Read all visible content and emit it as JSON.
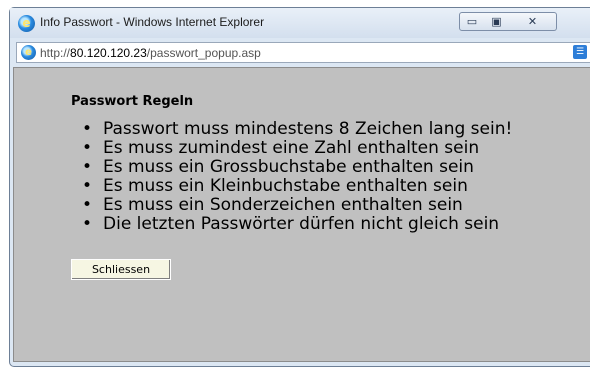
{
  "window": {
    "title": "Info Passwort - Windows Internet Explorer",
    "controls": {
      "minimize": "▭",
      "maximize": "▣",
      "close": "✕"
    }
  },
  "address_bar": {
    "protocol": "http://",
    "host": "80.120.120.23",
    "path": "/passwort_popup.asp"
  },
  "content": {
    "heading": "Passwort Regeln",
    "rules": [
      "Passwort muss mindestens 8 Zeichen lang sein!",
      "Es muss zumindest eine Zahl enthalten sein",
      "Es muss ein Grossbuchstabe enthalten sein",
      "Es muss ein Kleinbuchstabe enthalten sein",
      "Es muss ein Sonderzeichen enthalten sein",
      "Die letzten Passwörter dürfen nicht gleich sein"
    ],
    "close_button": "Schliessen"
  },
  "colors": {
    "content_background": "#c0c0c0",
    "titlebar": "#dce7f3",
    "button_face": "#f6f6e3"
  },
  "icons": [
    "ie-icon",
    "page-ie-icon",
    "rss-icon",
    "minimize-icon",
    "maximize-icon",
    "close-icon"
  ]
}
